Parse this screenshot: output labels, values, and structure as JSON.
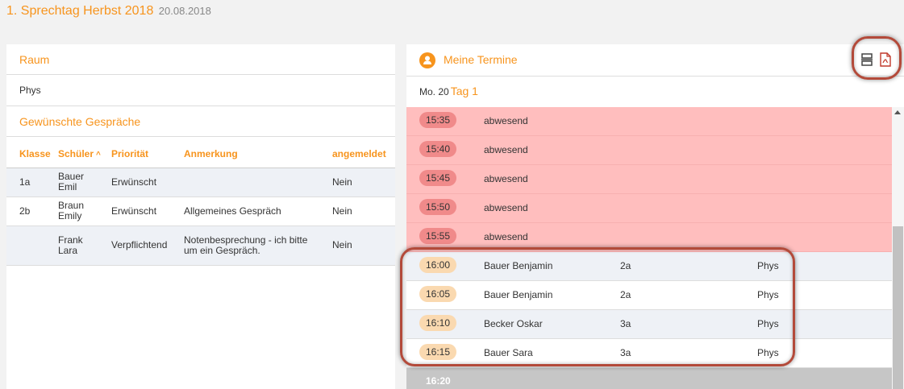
{
  "header": {
    "title": "1. Sprechtag Herbst 2018",
    "date": "20.08.2018"
  },
  "left": {
    "room_title": "Raum",
    "room_value": "Phys",
    "requests_title": "Gewünschte Gespräche",
    "columns": {
      "klasse": "Klasse",
      "schueler": "Schüler",
      "prioritaet": "Priorität",
      "anmerkung": "Anmerkung",
      "angemeldet": "angemeldet"
    },
    "rows": [
      {
        "klasse": "1a",
        "first": "Bauer",
        "second": "Emil",
        "prioritaet": "Erwünscht",
        "anmerkung": "",
        "anmerkung2": "",
        "angemeldet": "Nein"
      },
      {
        "klasse": "2b",
        "first": "Braun",
        "second": "Emily",
        "prioritaet": "Erwünscht",
        "anmerkung": "Allgemeines Gespräch",
        "anmerkung2": "",
        "angemeldet": "Nein"
      },
      {
        "klasse": "",
        "first": "Frank",
        "second": "Lara",
        "prioritaet": "Verpflichtend",
        "anmerkung": "Notenbesprechung - ich bitte",
        "anmerkung2": "um ein Gespräch.",
        "angemeldet": "Nein"
      }
    ]
  },
  "right": {
    "title": "Meine Termine",
    "day_num": "Mo. 20",
    "day_tag": "Tag 1",
    "slots": [
      {
        "time": "15:35",
        "name": "abwesend",
        "cls": "",
        "room": ""
      },
      {
        "time": "15:40",
        "name": "abwesend",
        "cls": "",
        "room": ""
      },
      {
        "time": "15:45",
        "name": "abwesend",
        "cls": "",
        "room": ""
      },
      {
        "time": "15:50",
        "name": "abwesend",
        "cls": "",
        "room": ""
      },
      {
        "time": "15:55",
        "name": "abwesend",
        "cls": "",
        "room": ""
      },
      {
        "time": "16:00",
        "name": "Bauer Benjamin",
        "cls": "2a",
        "room": "Phys"
      },
      {
        "time": "16:05",
        "name": "Bauer Benjamin",
        "cls": "2a",
        "room": "Phys"
      },
      {
        "time": "16:10",
        "name": "Becker Oskar",
        "cls": "3a",
        "room": "Phys"
      },
      {
        "time": "16:15",
        "name": "Bauer Sara",
        "cls": "3a",
        "room": "Phys"
      },
      {
        "time": "16:20",
        "name": "",
        "cls": "",
        "room": ""
      }
    ]
  },
  "icons": {
    "user": "user-icon",
    "list": "list-view-icon",
    "pdf": "pdf-icon",
    "sort": "sort-ascending-icon",
    "scroll_up": "scroll-up-arrow-icon"
  },
  "colors": {
    "accent": "#f7941d",
    "absent_bg": "#ffbebe",
    "absent_pill": "#f08a8a",
    "booked_pill": "#fad9b0",
    "annotation": "#b34a3a"
  }
}
